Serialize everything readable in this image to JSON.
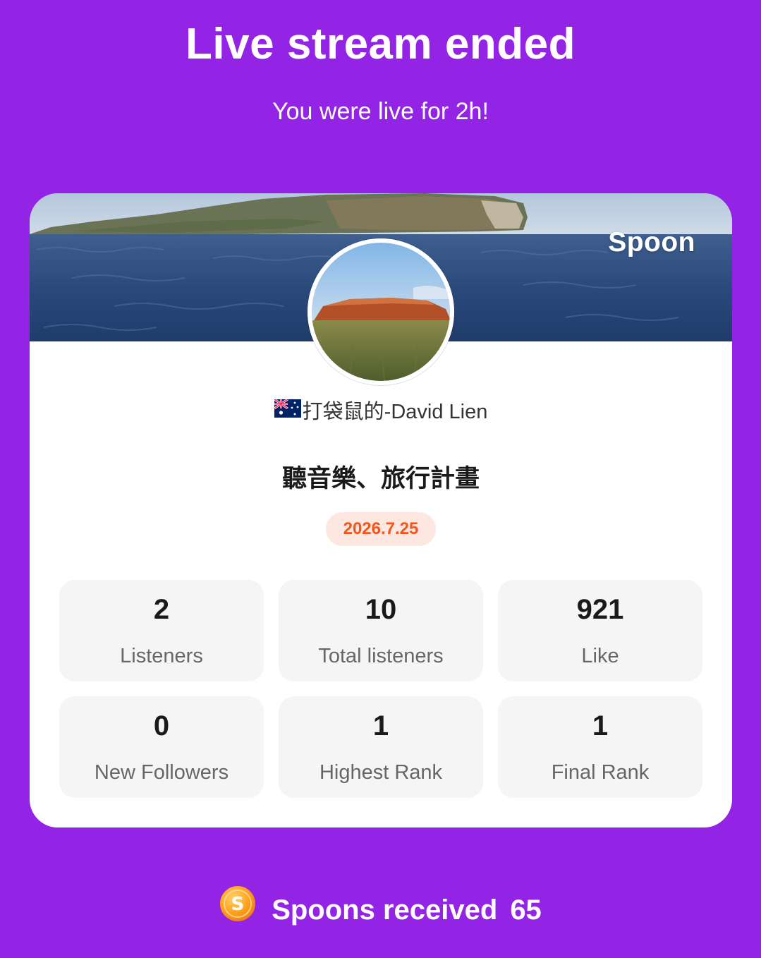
{
  "header": {
    "title": "Live stream ended",
    "subtitle": "You were live for 2h!"
  },
  "card": {
    "brand": "Spoon",
    "username": "打袋鼠的-David Lien",
    "country_flag": "australia-flag-icon",
    "stream_title": "聽音樂、旅行計畫",
    "date": "2026.7.25",
    "stats": [
      {
        "value": "2",
        "label": "Listeners"
      },
      {
        "value": "10",
        "label": "Total listeners"
      },
      {
        "value": "921",
        "label": "Like"
      },
      {
        "value": "0",
        "label": "New Followers"
      },
      {
        "value": "1",
        "label": "Highest Rank"
      },
      {
        "value": "1",
        "label": "Final Rank"
      }
    ]
  },
  "footer": {
    "coin_icon": "spoon-coin-icon",
    "spoons_label": "Spoons received",
    "spoons_value": "65"
  },
  "colors": {
    "background": "#9324e6",
    "date_badge_text": "#f2541b",
    "date_badge_bg": "#fde7e1",
    "stat_tile_bg": "#f5f5f5"
  }
}
